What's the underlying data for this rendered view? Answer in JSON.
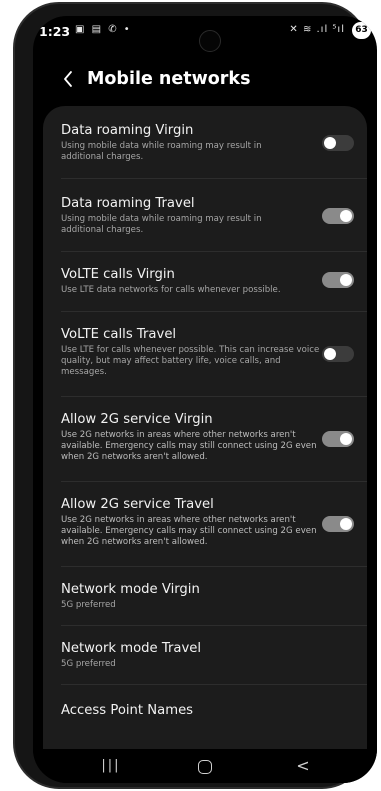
{
  "status_bar": {
    "time": "1:23",
    "left_icons": "▣ ▤ ✆ •",
    "right_icons": "✕ ≋ .ıl ⁵ıl",
    "battery": "63"
  },
  "header": {
    "back_icon": "chevron-left-icon",
    "title": "Mobile networks"
  },
  "settings": {
    "items": [
      {
        "title": "Data roaming Virgin",
        "subtitle": "Using mobile data while roaming may result in additional charges.",
        "toggle": "off"
      },
      {
        "title": "Data roaming Travel",
        "subtitle": "Using mobile data while roaming may result in additional charges.",
        "toggle": "on"
      },
      {
        "title": "VoLTE calls Virgin",
        "subtitle": "Use LTE data networks for calls whenever possible.",
        "toggle": "on"
      },
      {
        "title": "VoLTE calls Travel",
        "subtitle": "Use LTE for calls whenever possible. This can increase voice quality, but may affect battery life, voice calls, and messages.",
        "toggle": "off"
      },
      {
        "title": "Allow 2G service Virgin",
        "subtitle": "Use 2G networks in areas where other networks aren't available. Emergency calls may still connect using 2G even when 2G networks aren't allowed.",
        "toggle": "on"
      },
      {
        "title": "Allow 2G service Travel",
        "subtitle": "Use 2G networks in areas where other networks aren't available. Emergency calls may still connect using 2G even when 2G networks aren't allowed.",
        "toggle": "on"
      },
      {
        "title": "Network mode Virgin",
        "subtitle": "5G preferred"
      },
      {
        "title": "Network mode Travel",
        "subtitle": "5G preferred"
      },
      {
        "title": "Access Point Names"
      }
    ]
  },
  "nav_bar": {
    "recents": "|||",
    "home_icon": "home-icon",
    "back": "<"
  },
  "colors": {
    "background": "#000000",
    "card": "#1c1c1c",
    "toggle_on": "#8a8a8a",
    "toggle_off": "#3c3c3c"
  }
}
